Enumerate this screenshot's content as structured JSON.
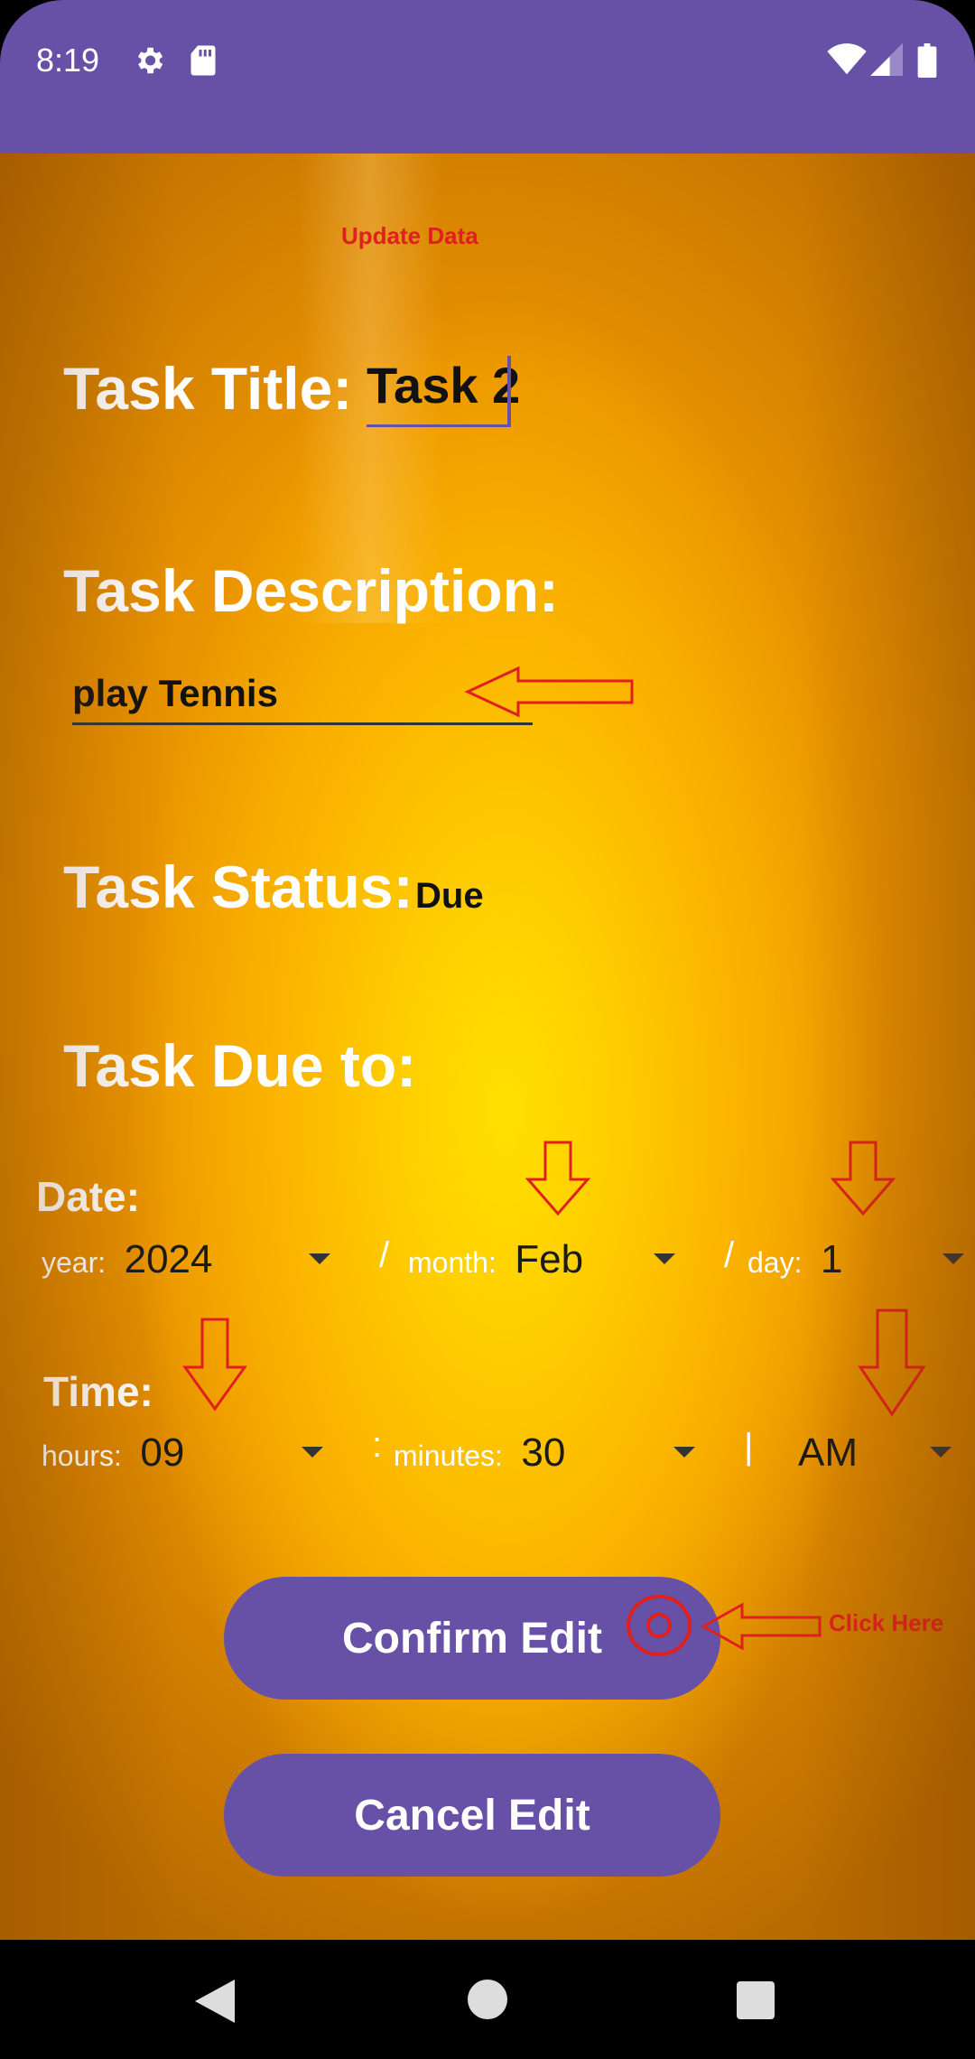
{
  "status_bar": {
    "time": "8:19"
  },
  "header": {
    "update_label": "Update Data"
  },
  "task_title": {
    "label": "Task Title:",
    "value": "Task 2"
  },
  "task_description": {
    "label": "Task Description:",
    "value": "play Tennis"
  },
  "task_status": {
    "label": "Task Status:",
    "value": "Due"
  },
  "task_due": {
    "label": "Task Due to:"
  },
  "date": {
    "label": "Date:",
    "year_label": "year:",
    "year_value": "2024",
    "sep1": "/",
    "month_label": "month:",
    "month_value": "Feb",
    "sep2": "/",
    "day_label": "day:",
    "day_value": "1"
  },
  "time": {
    "label": "Time:",
    "hours_label": "hours:",
    "hours_value": "09",
    "sep1": ":",
    "minutes_label": "minutes:",
    "minutes_value": "30",
    "sep2": "|",
    "ampm_value": "AM"
  },
  "buttons": {
    "confirm": "Confirm Edit",
    "cancel": "Cancel Edit"
  },
  "annotation": {
    "click_here": "Click Here"
  },
  "colors": {
    "accent": "#6651A6",
    "annotation_red": "#E0201E"
  }
}
